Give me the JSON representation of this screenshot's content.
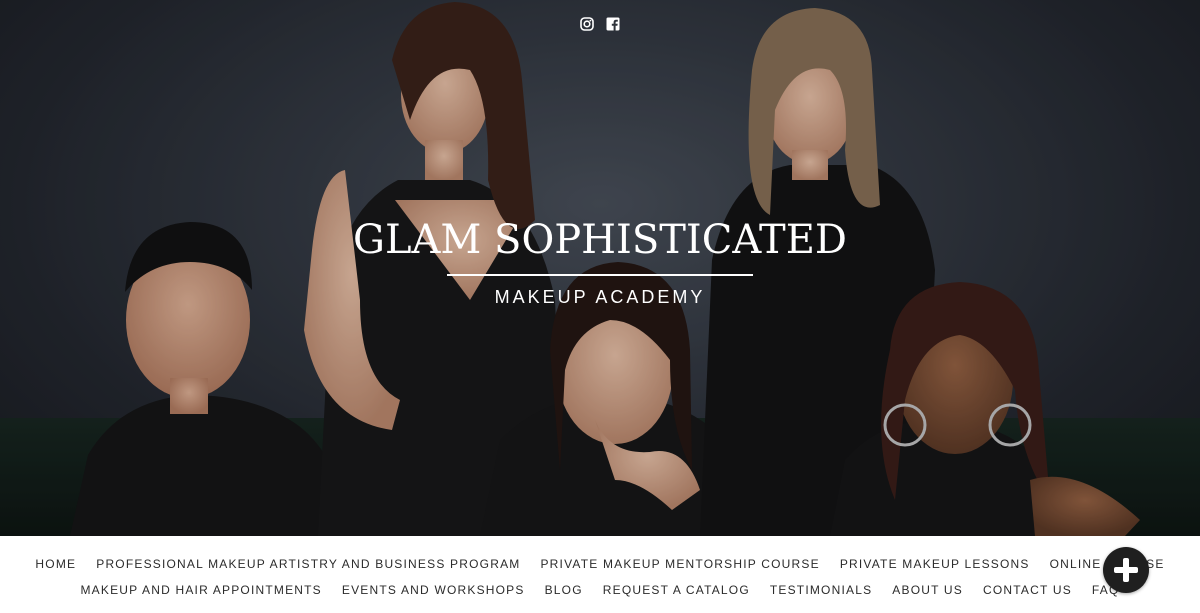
{
  "hero": {
    "brand_title": "GLAM SOPHISTICATED",
    "brand_subtitle": "MAKEUP ACADEMY",
    "social": [
      {
        "icon": "instagram-icon"
      },
      {
        "icon": "facebook-icon"
      }
    ],
    "background_color": "#2f343b"
  },
  "nav": {
    "row1": [
      "HOME",
      "PROFESSIONAL MAKEUP ARTISTRY AND BUSINESS PROGRAM",
      "PRIVATE MAKEUP MENTORSHIP COURSE",
      "PRIVATE MAKEUP LESSONS",
      "ONLINE COURSE"
    ],
    "row2": [
      "MAKEUP AND HAIR APPOINTMENTS",
      "EVENTS AND WORKSHOPS",
      "BLOG",
      "REQUEST A CATALOG",
      "TESTIMONIALS",
      "ABOUT US",
      "CONTACT US",
      "FAQ"
    ]
  },
  "fab": {
    "icon": "plus-icon",
    "color": "#1f1f1f"
  }
}
